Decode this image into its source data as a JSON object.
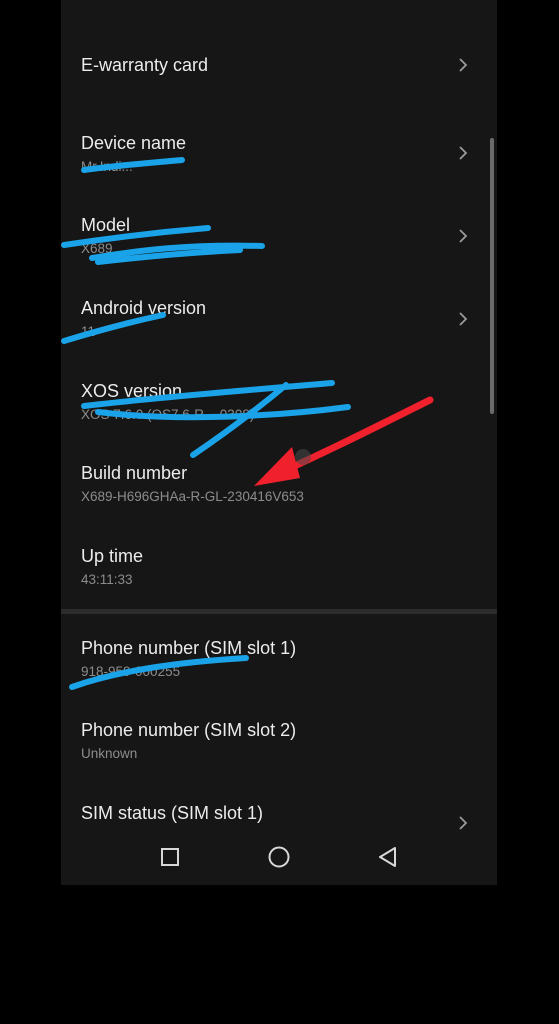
{
  "settings": {
    "items": [
      {
        "title": "E-warranty card",
        "subtitle": ""
      },
      {
        "title": "Device name",
        "subtitle": "Mr.Indi..."
      },
      {
        "title": "Model",
        "subtitle": "X689"
      },
      {
        "title": "Android version",
        "subtitle": "11"
      },
      {
        "title": "XOS version",
        "subtitle": "XOS 7.6.0 (OS7.6-R-...0308)"
      },
      {
        "title": "Build number",
        "subtitle": "X689-H696GHAa-R-GL-230416V653"
      },
      {
        "title": "Up time",
        "subtitle": "43:11:33"
      },
      {
        "title": "Phone number (SIM slot 1)",
        "subtitle": "918-959-000255"
      },
      {
        "title": "Phone number (SIM slot 2)",
        "subtitle": "Unknown"
      },
      {
        "title": "SIM status (SIM slot 1)",
        "subtitle": ""
      }
    ]
  },
  "icons": {
    "chevron": "chevron-right-icon",
    "recents": "square-recents-icon",
    "home": "circle-home-icon",
    "back": "triangle-back-icon"
  },
  "colors": {
    "background": "#161616",
    "title_text": "#ececec",
    "subtitle_text": "#8c8c8c",
    "scribble": "#1aa3e8",
    "annotation_arrow": "#f0212c"
  }
}
